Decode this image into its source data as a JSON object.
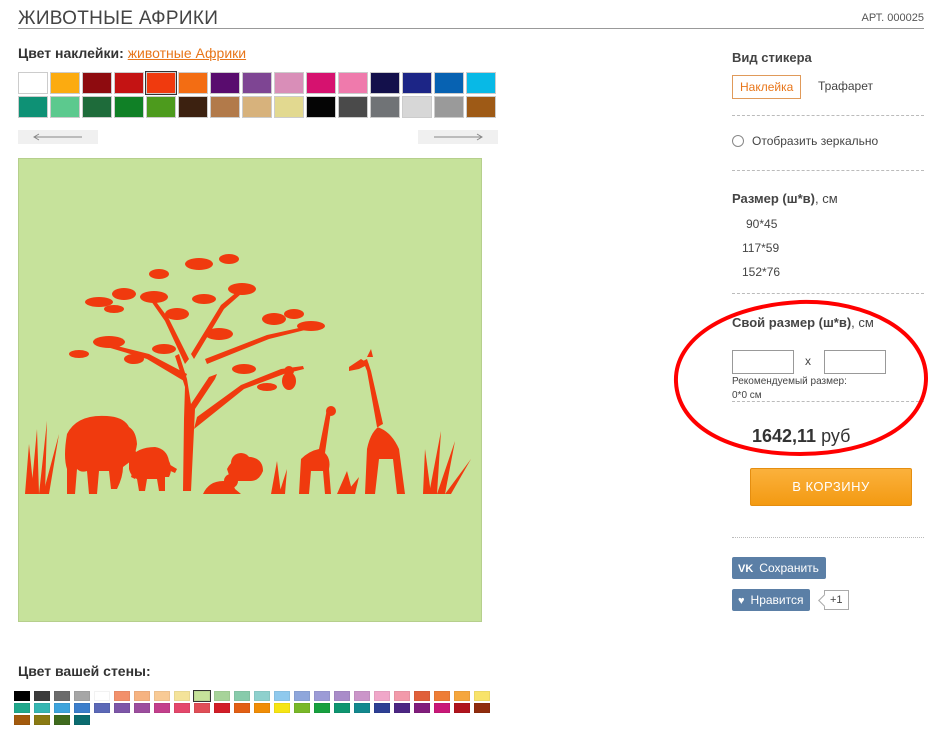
{
  "header": {
    "title": "ЖИВОТНЫЕ АФРИКИ",
    "article": "АРТ. 000025"
  },
  "sticker_color": {
    "label": "Цвет наклейки:",
    "value_link": "животные Африки",
    "swatches": [
      "#ffffff",
      "#fcab10",
      "#8e0b0f",
      "#c41313",
      "#f03a0e",
      "#f36d13",
      "#590c6e",
      "#7e4593",
      "#d98eb8",
      "#d6126f",
      "#ef7aac",
      "#13104b",
      "#1c2586",
      "#0762b2",
      "#08b9e6",
      "#0e9175",
      "#5cc98e",
      "#1e6b3a",
      "#108026",
      "#4d9b1d",
      "#3c2110",
      "#b27a4a",
      "#d7b27c",
      "#e2d990",
      "#050505",
      "#4a4a4a",
      "#707376",
      "#d7d7d7",
      "#9a9a9a",
      "#9e5a16"
    ],
    "selected_index": 4,
    "prev_arrow": "arrow-left-icon",
    "next_arrow": "arrow-right-icon"
  },
  "preview": {
    "background": "#c6e29b",
    "sticker_color": "#f03a0e"
  },
  "wall_color": {
    "label": "Цвет вашей стены:",
    "swatches": [
      "#000000",
      "#3b3b3b",
      "#6c6c6c",
      "#a6a6a6",
      "#ffffff",
      "#f2906b",
      "#f6b381",
      "#f8ca95",
      "#f4e39a",
      "#c6e29b",
      "#a7d39a",
      "#88cbab",
      "#8ed0cd",
      "#8fc9ed",
      "#8ea6db",
      "#9c9bd6",
      "#a98cc9",
      "#cb95c9",
      "#f0a7c9",
      "#f29aaa",
      "#e0603a",
      "#ee7d36",
      "#f5a63d",
      "#f8e36a",
      "#21a88c",
      "#36b6b2",
      "#3ea4dc",
      "#3c7ecb",
      "#5b68b7",
      "#7d56a8",
      "#9c4d9e",
      "#c33f8c",
      "#e4476b",
      "#e04e57",
      "#d21e28",
      "#e25f14",
      "#f08d06",
      "#f6e514",
      "#79b829",
      "#17a03f",
      "#0e9570",
      "#13888e",
      "#2d3f94",
      "#4c2683",
      "#811d7c",
      "#c91878",
      "#b0141d",
      "#902c0d",
      "#a35a0d",
      "#8a7a13",
      "#3f6a1e",
      "#0b6b6f"
    ],
    "selected_index": 9
  },
  "sticker_type": {
    "label": "Вид стикера",
    "options": [
      "Наклейка",
      "Трафарет"
    ],
    "selected_index": 0
  },
  "mirror": {
    "label": "Отобразить зеркально",
    "checked": false
  },
  "size": {
    "label": "Размер (ш*в)",
    "unit": ", см",
    "options": [
      "90*45",
      "117*59",
      "152*76"
    ]
  },
  "custom_size": {
    "label": "Свой размер (ш*в)",
    "unit": ", см",
    "width_value": "",
    "height_value": "",
    "separator": "x",
    "recommended_label": "Рекомендуемый размер:",
    "recommended_value": "0*0 см"
  },
  "price": {
    "amount": "1642,11",
    "currency": "руб"
  },
  "cart": {
    "label": "В КОРЗИНУ"
  },
  "social": {
    "save_icon": "vk-icon",
    "save_label": "Сохранить",
    "like_icon": "heart-icon",
    "like_label": "Нравится",
    "like_count": "+1"
  },
  "colors": {
    "accent": "#e8761a",
    "cart_button": "#f7a326",
    "social_button": "#5b7fa6",
    "highlight_ellipse": "#ff0000"
  }
}
